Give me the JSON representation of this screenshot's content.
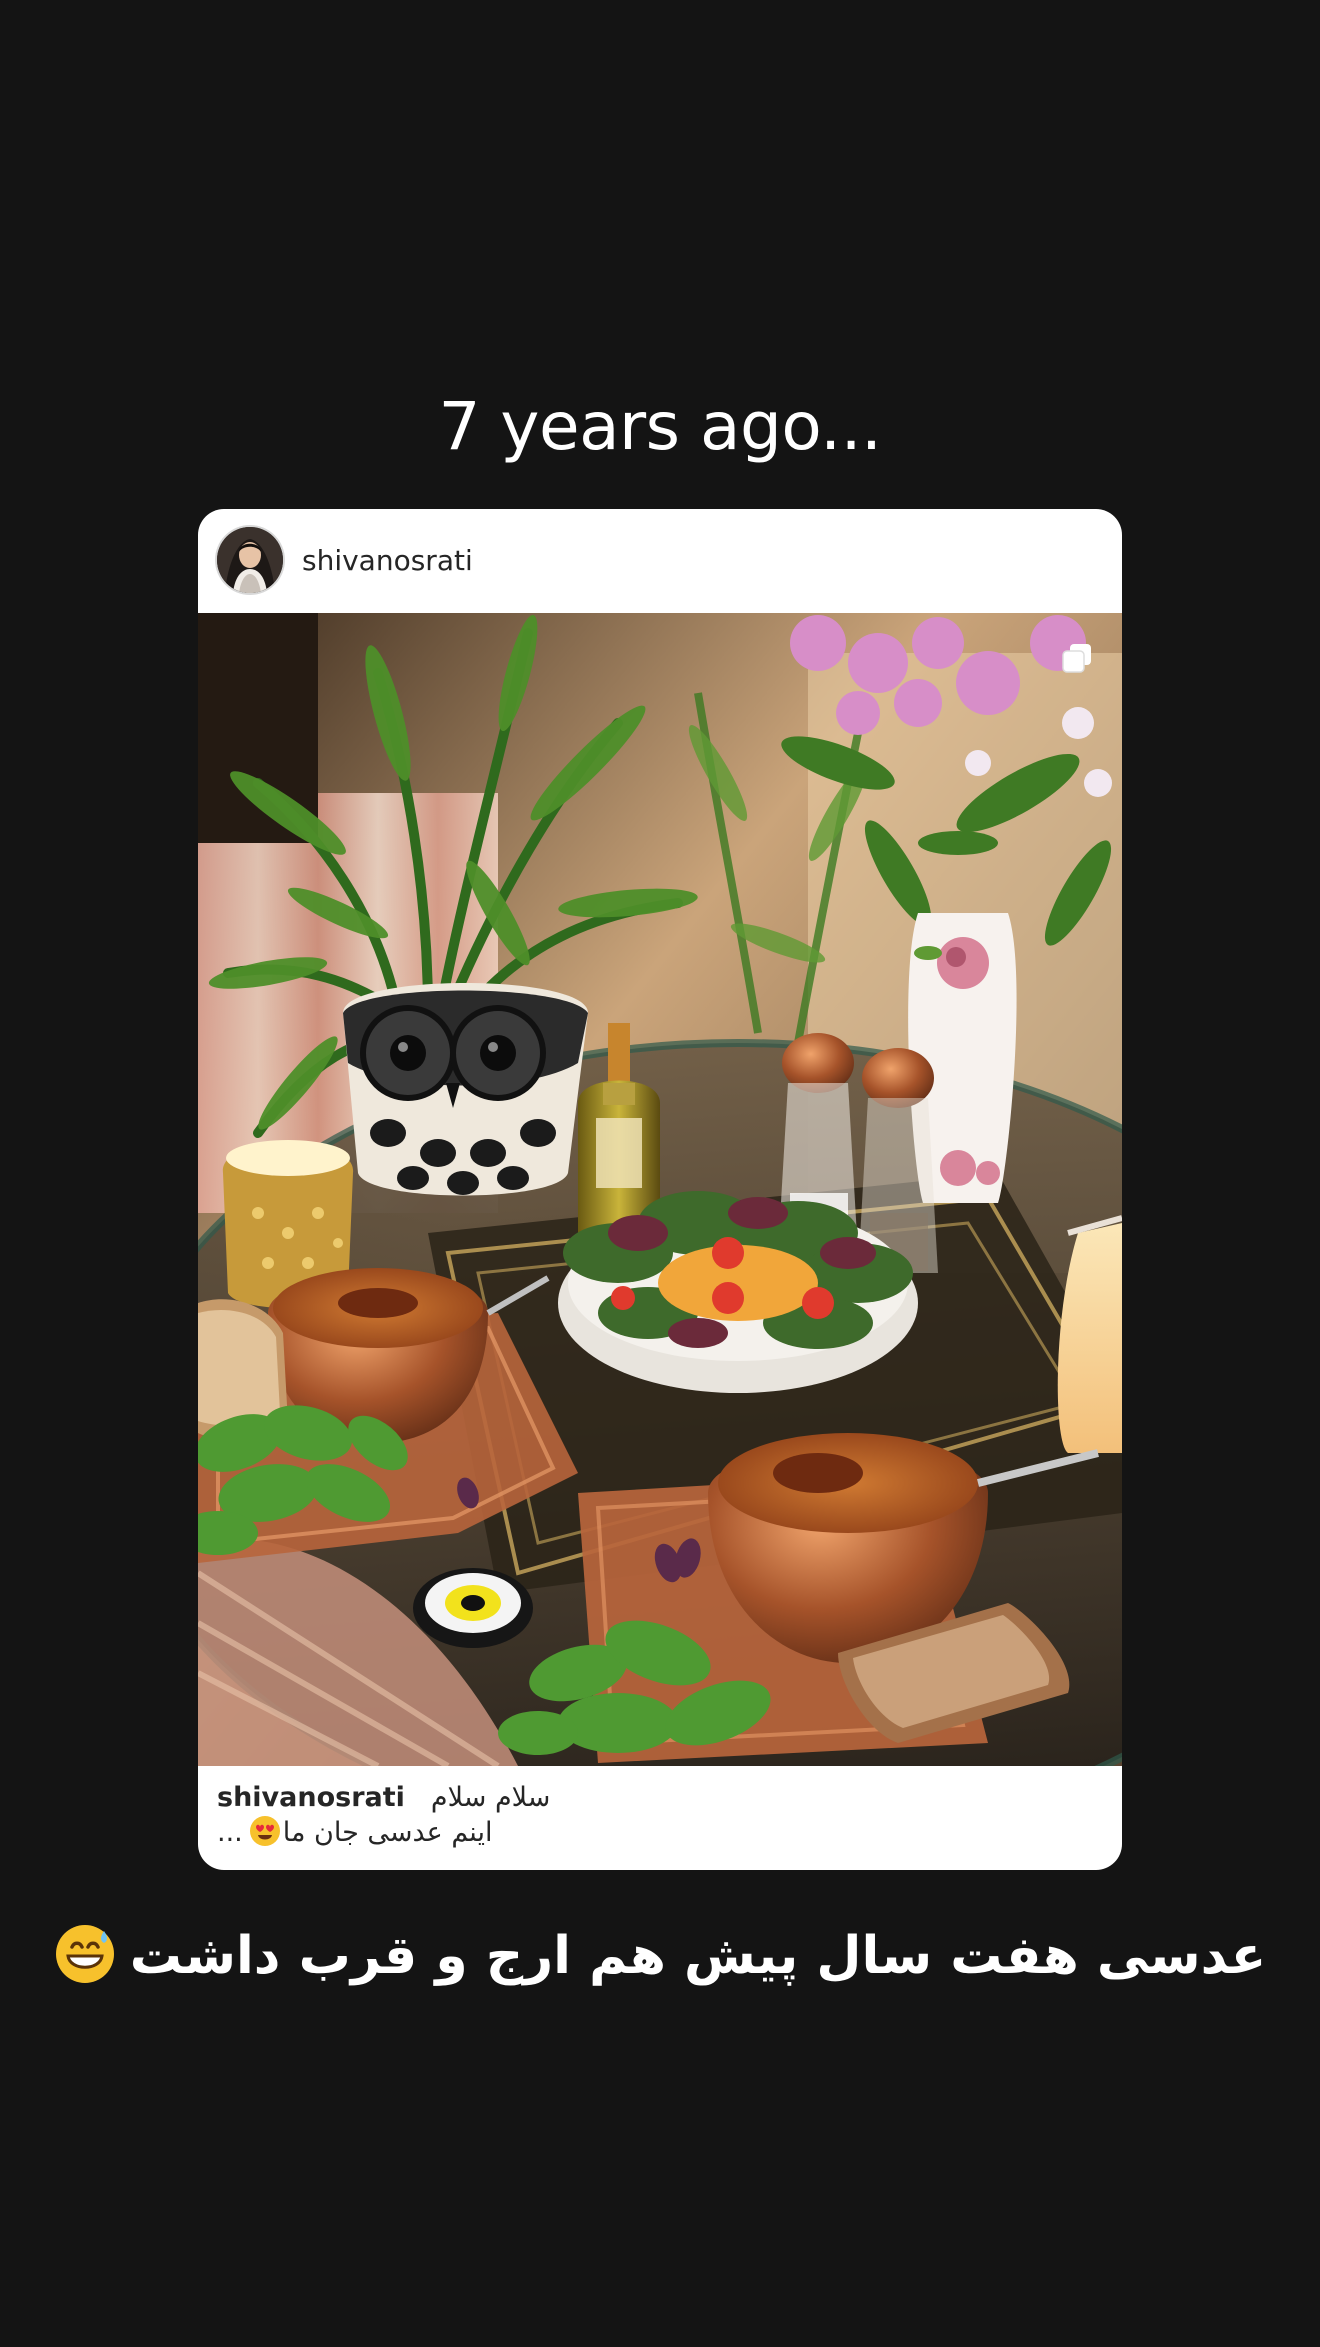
{
  "story": {
    "headline": "7 years ago...",
    "caption_text": "عدسی هفت سال پیش هم ارج و قرب داشت",
    "caption_emoji": "grinning-face-with-sweat-emoji"
  },
  "post": {
    "username": "shivanosrati",
    "image_alt": "Table set with two copper bowls of lentil soup, a salad bowl, fresh herbs, bread, olive oil bottle, salt and pepper shakers, owl planter and flower vase",
    "multi_image_icon": "carousel-icon",
    "caption": {
      "username": "shivanosrati",
      "greeting": "سلام سلام",
      "text": "اینم عدسی جان ما",
      "emoji": "heart-eyes-emoji",
      "more": "..."
    }
  },
  "colors": {
    "background": "#141414",
    "card": "#ffffff",
    "text_dark": "#262626",
    "text_light": "#ffffff"
  }
}
